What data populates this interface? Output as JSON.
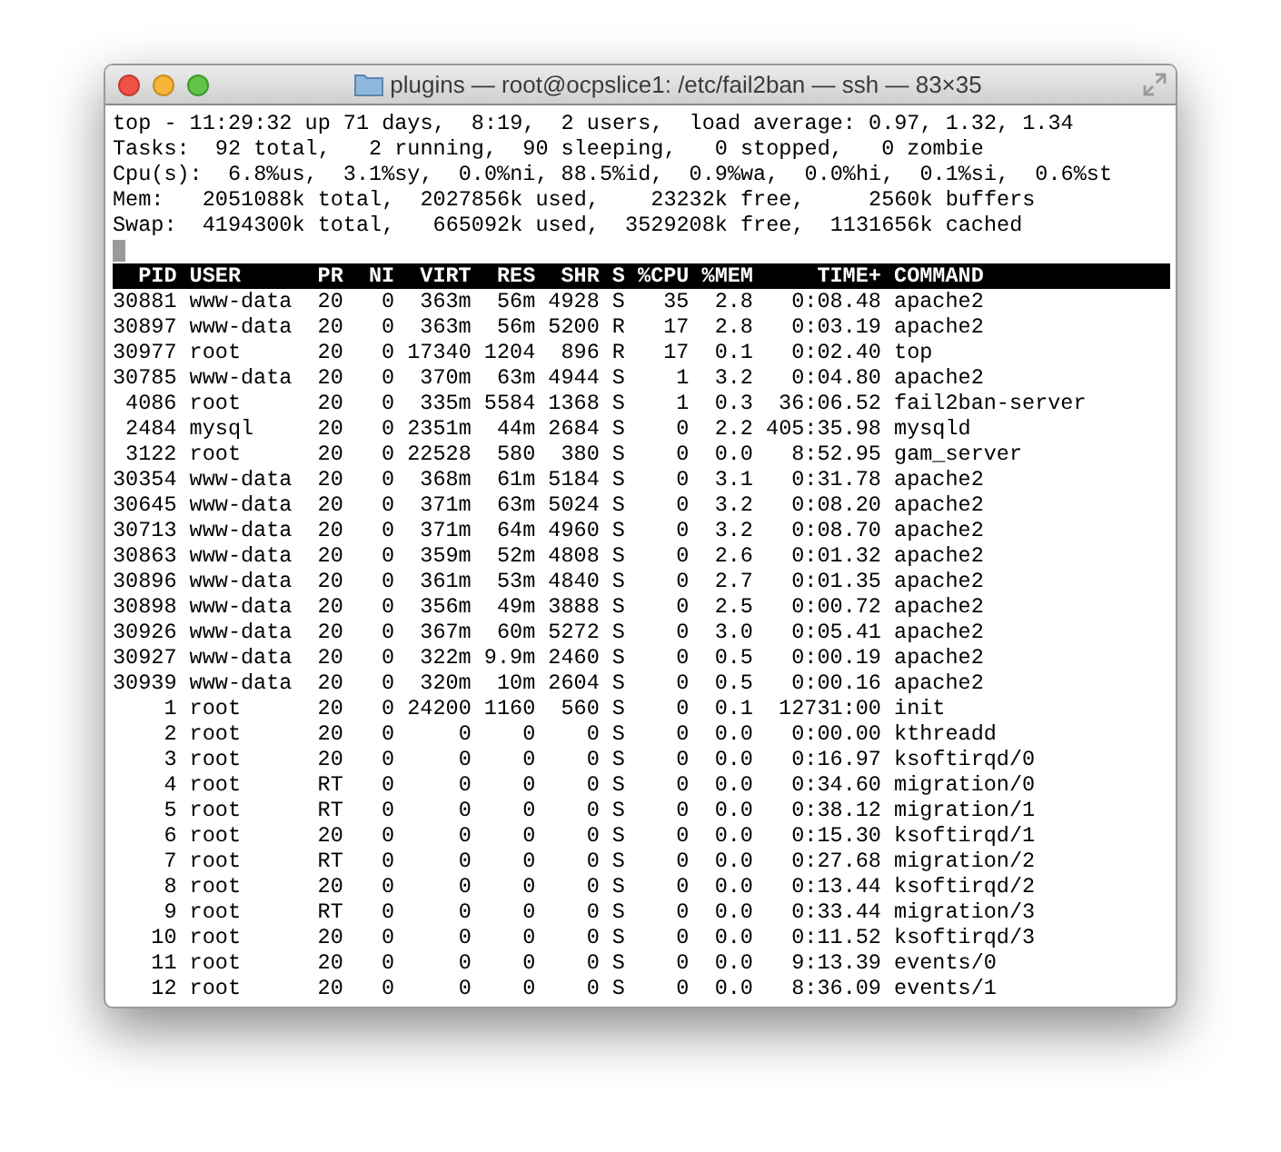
{
  "window": {
    "title": "plugins — root@ocpslice1: /etc/fail2ban — ssh — 83×35"
  },
  "summary_lines": [
    "top - 11:29:32 up 71 days,  8:19,  2 users,  load average: 0.97, 1.32, 1.34",
    "Tasks:  92 total,   2 running,  90 sleeping,   0 stopped,   0 zombie",
    "Cpu(s):  6.8%us,  3.1%sy,  0.0%ni, 88.5%id,  0.9%wa,  0.0%hi,  0.1%si,  0.6%st",
    "Mem:   2051088k total,  2027856k used,    23232k free,     2560k buffers",
    "Swap:  4194300k total,   665092k used,  3529208k free,  1131656k cached"
  ],
  "table": {
    "columns": [
      "PID",
      "USER",
      "PR",
      "NI",
      "VIRT",
      "RES",
      "SHR",
      "S",
      "%CPU",
      "%MEM",
      "TIME+",
      "COMMAND"
    ],
    "rows": [
      [
        "30881",
        "www-data",
        "20",
        "0",
        "363m",
        "56m",
        "4928",
        "S",
        "35",
        "2.8",
        "0:08.48",
        "apache2"
      ],
      [
        "30897",
        "www-data",
        "20",
        "0",
        "363m",
        "56m",
        "5200",
        "R",
        "17",
        "2.8",
        "0:03.19",
        "apache2"
      ],
      [
        "30977",
        "root",
        "20",
        "0",
        "17340",
        "1204",
        "896",
        "R",
        "17",
        "0.1",
        "0:02.40",
        "top"
      ],
      [
        "30785",
        "www-data",
        "20",
        "0",
        "370m",
        "63m",
        "4944",
        "S",
        "1",
        "3.2",
        "0:04.80",
        "apache2"
      ],
      [
        "4086",
        "root",
        "20",
        "0",
        "335m",
        "5584",
        "1368",
        "S",
        "1",
        "0.3",
        "36:06.52",
        "fail2ban-server"
      ],
      [
        "2484",
        "mysql",
        "20",
        "0",
        "2351m",
        "44m",
        "2684",
        "S",
        "0",
        "2.2",
        "405:35.98",
        "mysqld"
      ],
      [
        "3122",
        "root",
        "20",
        "0",
        "22528",
        "580",
        "380",
        "S",
        "0",
        "0.0",
        "8:52.95",
        "gam_server"
      ],
      [
        "30354",
        "www-data",
        "20",
        "0",
        "368m",
        "61m",
        "5184",
        "S",
        "0",
        "3.1",
        "0:31.78",
        "apache2"
      ],
      [
        "30645",
        "www-data",
        "20",
        "0",
        "371m",
        "63m",
        "5024",
        "S",
        "0",
        "3.2",
        "0:08.20",
        "apache2"
      ],
      [
        "30713",
        "www-data",
        "20",
        "0",
        "371m",
        "64m",
        "4960",
        "S",
        "0",
        "3.2",
        "0:08.70",
        "apache2"
      ],
      [
        "30863",
        "www-data",
        "20",
        "0",
        "359m",
        "52m",
        "4808",
        "S",
        "0",
        "2.6",
        "0:01.32",
        "apache2"
      ],
      [
        "30896",
        "www-data",
        "20",
        "0",
        "361m",
        "53m",
        "4840",
        "S",
        "0",
        "2.7",
        "0:01.35",
        "apache2"
      ],
      [
        "30898",
        "www-data",
        "20",
        "0",
        "356m",
        "49m",
        "3888",
        "S",
        "0",
        "2.5",
        "0:00.72",
        "apache2"
      ],
      [
        "30926",
        "www-data",
        "20",
        "0",
        "367m",
        "60m",
        "5272",
        "S",
        "0",
        "3.0",
        "0:05.41",
        "apache2"
      ],
      [
        "30927",
        "www-data",
        "20",
        "0",
        "322m",
        "9.9m",
        "2460",
        "S",
        "0",
        "0.5",
        "0:00.19",
        "apache2"
      ],
      [
        "30939",
        "www-data",
        "20",
        "0",
        "320m",
        "10m",
        "2604",
        "S",
        "0",
        "0.5",
        "0:00.16",
        "apache2"
      ],
      [
        "1",
        "root",
        "20",
        "0",
        "24200",
        "1160",
        "560",
        "S",
        "0",
        "0.1",
        "12731:00",
        "init"
      ],
      [
        "2",
        "root",
        "20",
        "0",
        "0",
        "0",
        "0",
        "S",
        "0",
        "0.0",
        "0:00.00",
        "kthreadd"
      ],
      [
        "3",
        "root",
        "20",
        "0",
        "0",
        "0",
        "0",
        "S",
        "0",
        "0.0",
        "0:16.97",
        "ksoftirqd/0"
      ],
      [
        "4",
        "root",
        "RT",
        "0",
        "0",
        "0",
        "0",
        "S",
        "0",
        "0.0",
        "0:34.60",
        "migration/0"
      ],
      [
        "5",
        "root",
        "RT",
        "0",
        "0",
        "0",
        "0",
        "S",
        "0",
        "0.0",
        "0:38.12",
        "migration/1"
      ],
      [
        "6",
        "root",
        "20",
        "0",
        "0",
        "0",
        "0",
        "S",
        "0",
        "0.0",
        "0:15.30",
        "ksoftirqd/1"
      ],
      [
        "7",
        "root",
        "RT",
        "0",
        "0",
        "0",
        "0",
        "S",
        "0",
        "0.0",
        "0:27.68",
        "migration/2"
      ],
      [
        "8",
        "root",
        "20",
        "0",
        "0",
        "0",
        "0",
        "S",
        "0",
        "0.0",
        "0:13.44",
        "ksoftirqd/2"
      ],
      [
        "9",
        "root",
        "RT",
        "0",
        "0",
        "0",
        "0",
        "S",
        "0",
        "0.0",
        "0:33.44",
        "migration/3"
      ],
      [
        "10",
        "root",
        "20",
        "0",
        "0",
        "0",
        "0",
        "S",
        "0",
        "0.0",
        "0:11.52",
        "ksoftirqd/3"
      ],
      [
        "11",
        "root",
        "20",
        "0",
        "0",
        "0",
        "0",
        "S",
        "0",
        "0.0",
        "9:13.39",
        "events/0"
      ],
      [
        "12",
        "root",
        "20",
        "0",
        "0",
        "0",
        "0",
        "S",
        "0",
        "0.0",
        "8:36.09",
        "events/1"
      ]
    ]
  }
}
